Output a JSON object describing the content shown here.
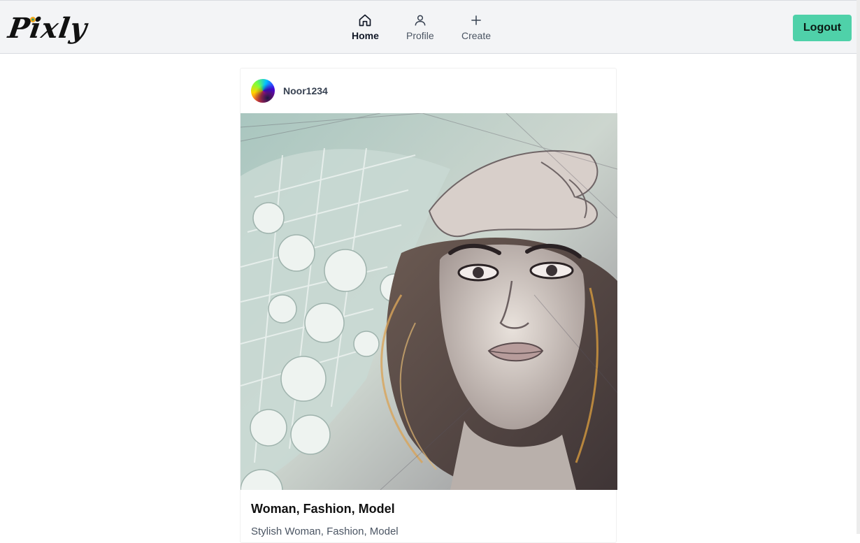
{
  "app": {
    "logo_text": "Pixly"
  },
  "nav": {
    "items": [
      {
        "label": "Home",
        "icon": "home-icon",
        "active": true
      },
      {
        "label": "Profile",
        "icon": "user-icon",
        "active": false
      },
      {
        "label": "Create",
        "icon": "plus-icon",
        "active": false
      }
    ],
    "logout_label": "Logout"
  },
  "post": {
    "username": "Noor1234",
    "image_icon": "portrait-sketch-image",
    "title": "Woman, Fashion, Model",
    "description": "Stylish Woman, Fashion, Model"
  },
  "colors": {
    "accent": "#4fd1a9",
    "topbar_bg": "#f3f4f6"
  }
}
